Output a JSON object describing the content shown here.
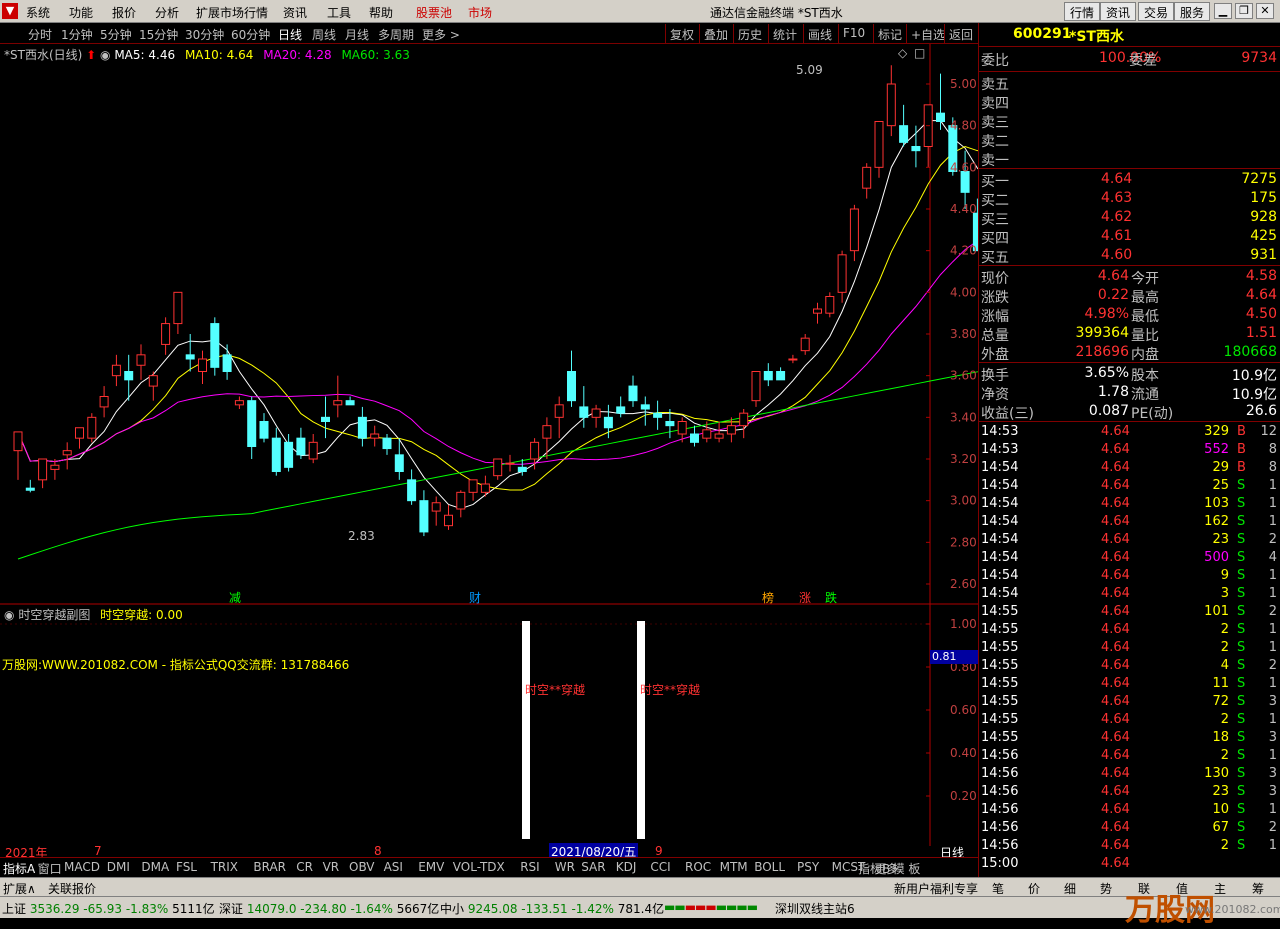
{
  "menu": {
    "items": [
      "系统",
      "功能",
      "报价",
      "分析",
      "扩展市场行情",
      "资讯",
      "工具",
      "帮助"
    ],
    "hl_items": [
      "股票池",
      "市场"
    ],
    "title": "通达信金融终端  *ST西水",
    "right_buttons": [
      "行情",
      "资讯",
      "交易",
      "服务"
    ]
  },
  "periods": [
    "分时",
    "1分钟",
    "5分钟",
    "15分钟",
    "30分钟",
    "60分钟",
    "日线",
    "周线",
    "月线",
    "多周期",
    "更多 >"
  ],
  "tools": [
    "复权",
    "叠加",
    "历史",
    "统计",
    "画线",
    "F10",
    "标记",
    "+自选",
    "返回"
  ],
  "chart": {
    "title": "*ST西水(日线)",
    "ma5": "MA5: 4.46",
    "ma10": "MA10: 4.64",
    "ma20": "MA20: 4.28",
    "ma60": "MA60: 3.63",
    "high_label": "5.09",
    "low_label": "2.83",
    "price_ticks": [
      "5.00",
      "4.80",
      "4.60",
      "4.40",
      "4.20",
      "4.00",
      "3.80",
      "3.60",
      "3.40",
      "3.20",
      "3.00",
      "2.80",
      "2.60"
    ],
    "events": [
      "减",
      "财",
      "榜",
      "涨",
      "跌"
    ],
    "sub_title": "时空穿越副图",
    "sub_value": "时空穿越: 0.00",
    "watermark_line": "万股网:WWW.201082.COM - 指标公式QQ交流群: 131788466",
    "sub_label": "时空**穿越",
    "sub_ticks": [
      "1.00",
      "0.80",
      "0.60",
      "0.40",
      "0.20"
    ],
    "sub_current": "0.81",
    "x_labels": [
      "2021年",
      "7",
      "8",
      "9"
    ],
    "x_highlight": "2021/08/20/五",
    "period_label": "日线",
    "colors": {
      "up": "#ff3232",
      "down": "#54ffff",
      "ma5": "#ffffff",
      "ma10": "#ffff00",
      "ma20": "#ff00ff",
      "ma60": "#00ff00"
    }
  },
  "indicator_tabs": [
    "指标A",
    "窗口",
    "MACD",
    "DMI",
    "DMA",
    "FSL",
    "TRIX",
    "BRAR",
    "CR",
    "VR",
    "OBV",
    "ASI",
    "EMV",
    "VOL-TDX",
    "RSI",
    "WR",
    "SAR",
    "KDJ",
    "CCI",
    "ROC",
    "MTM",
    "BOLL",
    "PSY",
    "MCST",
    "更多",
    "指标B",
    "模 板"
  ],
  "expand_bar": {
    "left": [
      "扩展∧",
      "关联报价"
    ],
    "right": [
      "新用户福利专享",
      "笔",
      "价",
      "细",
      "势",
      "联",
      "值",
      "主",
      "筹"
    ]
  },
  "quote": {
    "code": "600291",
    "name": "*ST西水",
    "wb_label": "委比",
    "wb_value": "100.00%",
    "wc_label": "委差",
    "wc_value": "9734",
    "sell": [
      {
        "label": "卖五"
      },
      {
        "label": "卖四"
      },
      {
        "label": "卖三"
      },
      {
        "label": "卖二"
      },
      {
        "label": "卖一"
      }
    ],
    "buy": [
      {
        "label": "买一",
        "price": "4.64",
        "vol": "7275"
      },
      {
        "label": "买二",
        "price": "4.63",
        "vol": "175"
      },
      {
        "label": "买三",
        "price": "4.62",
        "vol": "928"
      },
      {
        "label": "买四",
        "price": "4.61",
        "vol": "425"
      },
      {
        "label": "买五",
        "price": "4.60",
        "vol": "931"
      }
    ],
    "stats": [
      {
        "l1": "现价",
        "v1": "4.64",
        "c1": "red",
        "l2": "今开",
        "v2": "4.58",
        "c2": "red"
      },
      {
        "l1": "涨跌",
        "v1": "0.22",
        "c1": "red",
        "l2": "最高",
        "v2": "4.64",
        "c2": "red"
      },
      {
        "l1": "涨幅",
        "v1": "4.98%",
        "c1": "red",
        "l2": "最低",
        "v2": "4.50",
        "c2": "red"
      },
      {
        "l1": "总量",
        "v1": "399364",
        "c1": "yellow",
        "l2": "量比",
        "v2": "1.51",
        "c2": "red"
      },
      {
        "l1": "外盘",
        "v1": "218696",
        "c1": "red",
        "l2": "内盘",
        "v2": "180668",
        "c2": "green"
      }
    ],
    "stats2": [
      {
        "l1": "换手",
        "v1": "3.65%",
        "l2": "股本",
        "v2": "10.9亿"
      },
      {
        "l1": "净资",
        "v1": "1.78",
        "l2": "流通",
        "v2": "10.9亿"
      },
      {
        "l1": "收益(三)",
        "v1": "0.087",
        "l2": "PE(动)",
        "v2": "26.6"
      }
    ],
    "ticks": [
      {
        "t": "14:53",
        "p": "4.64",
        "v": "329",
        "vc": "yellow",
        "s": "B",
        "n": "12"
      },
      {
        "t": "14:53",
        "p": "4.64",
        "v": "552",
        "vc": "purple",
        "s": "B",
        "n": "8"
      },
      {
        "t": "14:54",
        "p": "4.64",
        "v": "29",
        "vc": "yellow",
        "s": "B",
        "n": "8"
      },
      {
        "t": "14:54",
        "p": "4.64",
        "v": "25",
        "vc": "yellow",
        "s": "S",
        "n": "1"
      },
      {
        "t": "14:54",
        "p": "4.64",
        "v": "103",
        "vc": "yellow",
        "s": "S",
        "n": "1"
      },
      {
        "t": "14:54",
        "p": "4.64",
        "v": "162",
        "vc": "yellow",
        "s": "S",
        "n": "1"
      },
      {
        "t": "14:54",
        "p": "4.64",
        "v": "23",
        "vc": "yellow",
        "s": "S",
        "n": "2"
      },
      {
        "t": "14:54",
        "p": "4.64",
        "v": "500",
        "vc": "purple",
        "s": "S",
        "n": "4"
      },
      {
        "t": "14:54",
        "p": "4.64",
        "v": "9",
        "vc": "yellow",
        "s": "S",
        "n": "1"
      },
      {
        "t": "14:54",
        "p": "4.64",
        "v": "3",
        "vc": "yellow",
        "s": "S",
        "n": "1"
      },
      {
        "t": "14:55",
        "p": "4.64",
        "v": "101",
        "vc": "yellow",
        "s": "S",
        "n": "2"
      },
      {
        "t": "14:55",
        "p": "4.64",
        "v": "2",
        "vc": "yellow",
        "s": "S",
        "n": "1"
      },
      {
        "t": "14:55",
        "p": "4.64",
        "v": "2",
        "vc": "yellow",
        "s": "S",
        "n": "1"
      },
      {
        "t": "14:55",
        "p": "4.64",
        "v": "4",
        "vc": "yellow",
        "s": "S",
        "n": "2"
      },
      {
        "t": "14:55",
        "p": "4.64",
        "v": "11",
        "vc": "yellow",
        "s": "S",
        "n": "1"
      },
      {
        "t": "14:55",
        "p": "4.64",
        "v": "72",
        "vc": "yellow",
        "s": "S",
        "n": "3"
      },
      {
        "t": "14:55",
        "p": "4.64",
        "v": "2",
        "vc": "yellow",
        "s": "S",
        "n": "1"
      },
      {
        "t": "14:55",
        "p": "4.64",
        "v": "18",
        "vc": "yellow",
        "s": "S",
        "n": "3"
      },
      {
        "t": "14:56",
        "p": "4.64",
        "v": "2",
        "vc": "yellow",
        "s": "S",
        "n": "1"
      },
      {
        "t": "14:56",
        "p": "4.64",
        "v": "130",
        "vc": "yellow",
        "s": "S",
        "n": "3"
      },
      {
        "t": "14:56",
        "p": "4.64",
        "v": "23",
        "vc": "yellow",
        "s": "S",
        "n": "3"
      },
      {
        "t": "14:56",
        "p": "4.64",
        "v": "10",
        "vc": "yellow",
        "s": "S",
        "n": "1"
      },
      {
        "t": "14:56",
        "p": "4.64",
        "v": "67",
        "vc": "yellow",
        "s": "S",
        "n": "2"
      },
      {
        "t": "14:56",
        "p": "4.64",
        "v": "2",
        "vc": "yellow",
        "s": "S",
        "n": "1"
      },
      {
        "t": "15:00",
        "p": "4.64",
        "v": "",
        "vc": "yellow",
        "s": "",
        "n": ""
      }
    ]
  },
  "status_bar": [
    {
      "name": "上证",
      "val": "3536.29",
      "chg": "-65.93",
      "pct": "-1.83%",
      "amt": "5111亿"
    },
    {
      "name": "深证",
      "val": "14079.0",
      "chg": "-234.80",
      "pct": "-1.64%",
      "amt": "5667亿"
    },
    {
      "name": "中小",
      "val": "9245.08",
      "chg": "-133.51",
      "pct": "-1.42%",
      "amt": "781.4亿"
    }
  ],
  "status_right": "深圳双线主站6",
  "brand": "万股网",
  "brand_url": "www.201082.com"
}
